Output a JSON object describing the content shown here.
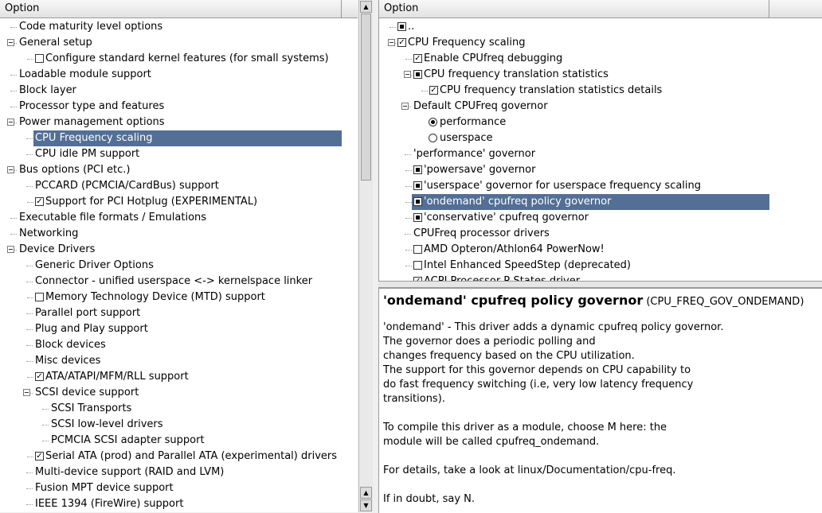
{
  "left_header": "Option",
  "right_header": "Option",
  "left_rows": [
    {
      "text": "Code maturity level options",
      "indent": 24,
      "expander": false
    },
    {
      "text": "General setup",
      "indent": 24,
      "expander": true
    },
    {
      "text": "Configure standard kernel features (for small systems)",
      "indent": 57,
      "check": "empty"
    },
    {
      "text": "Loadable module support",
      "indent": 24
    },
    {
      "text": "Block layer",
      "indent": 24
    },
    {
      "text": "Processor type and features",
      "indent": 24
    },
    {
      "text": "Power management options",
      "indent": 24,
      "expander": true
    },
    {
      "text": "CPU Frequency scaling",
      "indent": 44,
      "selected": true
    },
    {
      "text": "CPU idle PM support",
      "indent": 44
    },
    {
      "text": "Bus options (PCI etc.)",
      "indent": 24,
      "expander": true
    },
    {
      "text": "PCCARD (PCMCIA/CardBus) support",
      "indent": 44
    },
    {
      "text": "Support for PCI Hotplug (EXPERIMENTAL)",
      "indent": 57,
      "check": "checked"
    },
    {
      "text": "Executable file formats / Emulations",
      "indent": 24
    },
    {
      "text": "Networking",
      "indent": 24
    },
    {
      "text": "Device Drivers",
      "indent": 24,
      "expander": true
    },
    {
      "text": "Generic Driver Options",
      "indent": 44
    },
    {
      "text": "Connector - unified userspace <-> kernelspace linker",
      "indent": 44
    },
    {
      "text": "Memory Technology Device (MTD) support",
      "indent": 57,
      "check": "empty"
    },
    {
      "text": "Parallel port support",
      "indent": 44
    },
    {
      "text": "Plug and Play support",
      "indent": 44
    },
    {
      "text": "Block devices",
      "indent": 44
    },
    {
      "text": "Misc devices",
      "indent": 44
    },
    {
      "text": "ATA/ATAPI/MFM/RLL support",
      "indent": 57,
      "check": "checked"
    },
    {
      "text": "SCSI device support",
      "indent": 44,
      "expander": true
    },
    {
      "text": "SCSI Transports",
      "indent": 64
    },
    {
      "text": "SCSI low-level drivers",
      "indent": 64
    },
    {
      "text": "PCMCIA SCSI adapter support",
      "indent": 64
    },
    {
      "text": "Serial ATA (prod) and Parallel ATA (experimental) drivers",
      "indent": 57,
      "check": "checked"
    },
    {
      "text": "Multi-device support (RAID and LVM)",
      "indent": 44
    },
    {
      "text": "Fusion MPT device support",
      "indent": 44
    },
    {
      "text": "IEEE 1394 (FireWire) support",
      "indent": 44
    }
  ],
  "right_rows": [
    {
      "text": "..",
      "indent": 36,
      "check": "mod"
    },
    {
      "text": "CPU Frequency scaling",
      "indent": 36,
      "expander": true,
      "check": "checked"
    },
    {
      "text": "Enable CPUfreq debugging",
      "indent": 56,
      "check": "checked"
    },
    {
      "text": "CPU frequency translation statistics",
      "indent": 56,
      "expander": true,
      "check": "mod"
    },
    {
      "text": "CPU frequency translation statistics details",
      "indent": 76,
      "check": "checked"
    },
    {
      "text": "Default CPUFreq governor",
      "indent": 43,
      "expander": true
    },
    {
      "text": "performance",
      "indent": 76,
      "radio": "on"
    },
    {
      "text": "userspace",
      "indent": 76,
      "radio": "off"
    },
    {
      "text": "'performance' governor",
      "indent": 43
    },
    {
      "text": "'powersave' governor",
      "indent": 56,
      "check": "mod"
    },
    {
      "text": "'userspace' governor for userspace frequency scaling",
      "indent": 56,
      "check": "mod"
    },
    {
      "text": "'ondemand' cpufreq policy governor",
      "indent": 56,
      "check": "mod",
      "selected": true
    },
    {
      "text": "'conservative' cpufreq governor",
      "indent": 56,
      "check": "mod"
    },
    {
      "text": "CPUFreq processor drivers",
      "indent": 43
    },
    {
      "text": "AMD Opteron/Athlon64 PowerNow!",
      "indent": 56,
      "check": "empty"
    },
    {
      "text": "Intel Enhanced SpeedStep (deprecated)",
      "indent": 56,
      "check": "empty"
    },
    {
      "text": "ACPI Processor P-States driver",
      "indent": 56,
      "check": "checked"
    }
  ],
  "help": {
    "title": "'ondemand' cpufreq policy governor",
    "symbol": "(CPU_FREQ_GOV_ONDEMAND)",
    "paragraphs": [
      [
        "'ondemand' - This driver adds a dynamic cpufreq policy governor.",
        "The governor does a periodic polling and",
        "changes frequency based on the CPU utilization.",
        "The support for this governor depends on CPU capability to",
        "do fast frequency switching (i.e, very low latency frequency",
        "transitions)."
      ],
      [
        "To compile this driver as a module, choose M here: the",
        "module will be called cpufreq_ondemand."
      ],
      [
        "For details, take a look at linux/Documentation/cpu-freq."
      ],
      [
        "If in doubt, say N."
      ]
    ]
  },
  "colors": {
    "selection": "#536f95"
  }
}
